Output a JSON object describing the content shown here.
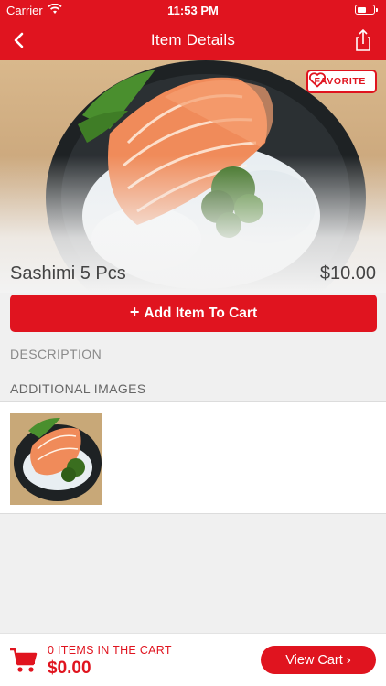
{
  "status_bar": {
    "carrier": "Carrier",
    "time": "11:53 PM",
    "battery_level": 0.45
  },
  "nav": {
    "title": "Item Details",
    "back_icon": "chevron-left-icon",
    "share_icon": "share-icon"
  },
  "hero": {
    "favorite_label": "FAVORITE",
    "favorite_icon": "heart-icon"
  },
  "item": {
    "name": "Sashimi 5 Pcs",
    "price": "$10.00"
  },
  "add_button": {
    "icon": "+",
    "label": "Add Item To Cart"
  },
  "sections": {
    "description": "DESCRIPTION",
    "additional_images": "ADDITIONAL IMAGES"
  },
  "cart": {
    "count_text": "0 ITEMS IN THE CART",
    "total": "$0.00",
    "view_label": "View Cart",
    "view_chevron": "›",
    "icon": "cart-icon"
  },
  "colors": {
    "accent": "#e0141f"
  }
}
